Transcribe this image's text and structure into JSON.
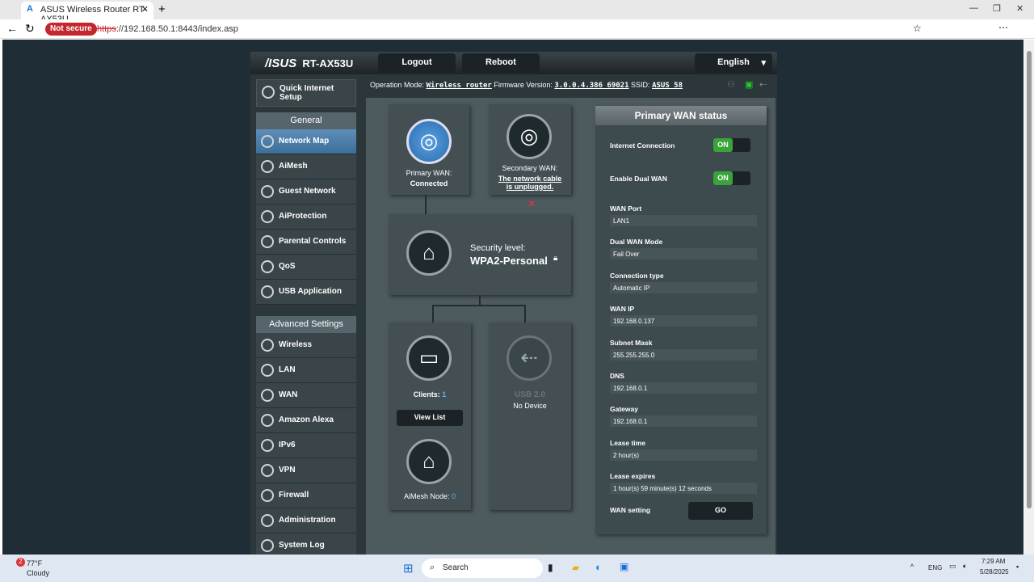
{
  "browser": {
    "tab_title": "ASUS Wireless Router RT-AX53U",
    "not_secure": "Not secure",
    "url_scheme": "https",
    "url_rest": "://192.168.50.1:8443/index.asp"
  },
  "header": {
    "logo": "/ISUS",
    "model": "RT-AX53U",
    "logout": "Logout",
    "reboot": "Reboot",
    "language": "English"
  },
  "info": {
    "op_label": "Operation Mode:",
    "op_value": "Wireless router",
    "fw_label": "Firmware Version:",
    "fw_value": "3.0.0.4.386_69021",
    "ssid_label": "SSID:",
    "ssid_value": "ASUS_58"
  },
  "sidebar": {
    "quick": "Quick Internet Setup",
    "general": "General",
    "general_items": [
      "Network Map",
      "AiMesh",
      "Guest Network",
      "AiProtection",
      "Parental Controls",
      "QoS",
      "USB Application"
    ],
    "advanced": "Advanced Settings",
    "advanced_items": [
      "Wireless",
      "LAN",
      "WAN",
      "Amazon Alexa",
      "IPv6",
      "VPN",
      "Firewall",
      "Administration",
      "System Log"
    ]
  },
  "map": {
    "primary_wan": "Primary WAN:",
    "primary_status": "Connected",
    "secondary_wan": "Secondary WAN:",
    "secondary_status": "The network cable is unplugged.",
    "security_label": "Security level:",
    "security_value": "WPA2-Personal",
    "clients_label": "Clients:",
    "clients_count": "1",
    "view_list": "View List",
    "usb_label": "USB 2.0",
    "usb_status": "No Device",
    "aimesh_label": "AiMesh Node:",
    "aimesh_count": "0"
  },
  "wan": {
    "title": "Primary WAN status",
    "internet_label": "Internet Connection",
    "internet_toggle": "ON",
    "dual_label": "Enable Dual WAN",
    "dual_toggle": "ON",
    "fields": [
      {
        "label": "WAN Port",
        "value": "LAN1"
      },
      {
        "label": "Dual WAN Mode",
        "value": "Fail Over"
      },
      {
        "label": "Connection type",
        "value": "Automatic IP"
      },
      {
        "label": "WAN IP",
        "value": "192.168.0.137"
      },
      {
        "label": "Subnet Mask",
        "value": "255.255.255.0"
      },
      {
        "label": "DNS",
        "value": "192.168.0.1"
      },
      {
        "label": "Gateway",
        "value": "192.168.0.1"
      },
      {
        "label": "Lease time",
        "value": "2 hour(s)"
      },
      {
        "label": "Lease expires",
        "value": "1 hour(s) 59 minute(s) 12 seconds"
      }
    ],
    "setting_label": "WAN setting",
    "go": "GO"
  },
  "taskbar": {
    "weather_temp": "77°F",
    "weather_desc": "Cloudy",
    "badge": "2",
    "search": "Search",
    "lang": "ENG",
    "time": "7:29 AM",
    "date": "5/28/2025"
  }
}
